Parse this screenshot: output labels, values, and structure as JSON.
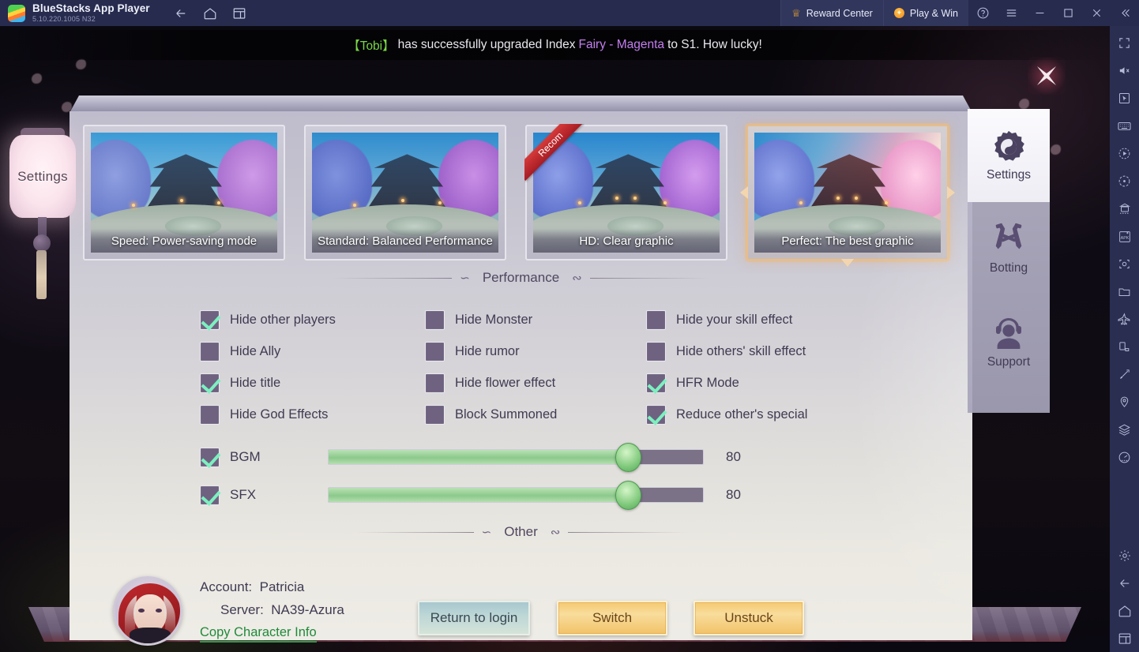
{
  "titlebar": {
    "app_title": "BlueStacks App Player",
    "version": "5.10.220.1005  N32",
    "nav": [
      {
        "name": "back-button",
        "icon": "arrow-left-icon"
      },
      {
        "name": "home-button",
        "icon": "home-icon"
      },
      {
        "name": "multi-instance-button",
        "icon": "windows-icon"
      }
    ],
    "reward_center": "Reward Center",
    "play_and_win": "Play & Win",
    "window_controls": [
      "help-icon",
      "menu-icon",
      "minimize-icon",
      "maximize-icon",
      "close-icon",
      "collapse-icon"
    ]
  },
  "bs_sidebar": {
    "icons": [
      "fullscreen-icon",
      "mute-icon",
      "pointer-icon",
      "keyboard-icon",
      "record-icon",
      "macro-icon",
      "multi-instance-manager-icon",
      "install-apk-icon",
      "screenshot-icon",
      "media-folder-icon",
      "airplane-icon",
      "rotate-icon",
      "trim-icon",
      "location-icon",
      "layers-icon",
      "performance-icon",
      "settings-gear-icon",
      "back-icon",
      "home-icon",
      "recents-icon"
    ]
  },
  "notification": {
    "player": "【Tobi】",
    "mid_text": "has successfully upgraded Index",
    "item": "Fairy - Magenta",
    "end_text": "to S1. How lucky!",
    "close_icon": "close-x-icon"
  },
  "left_tab": {
    "label": "Settings"
  },
  "presets": {
    "ribbon_label": "Recom",
    "items": [
      {
        "name": "preset-speed",
        "label": "Speed: Power-saving mode",
        "selected": false,
        "recommended": false
      },
      {
        "name": "preset-standard",
        "label": "Standard: Balanced Performance",
        "selected": false,
        "recommended": false
      },
      {
        "name": "preset-hd",
        "label": "HD: Clear graphic",
        "selected": false,
        "recommended": true
      },
      {
        "name": "preset-perfect",
        "label": "Perfect: The best graphic",
        "selected": true,
        "recommended": false
      }
    ]
  },
  "sections": {
    "performance": "Performance",
    "other": "Other"
  },
  "options": [
    {
      "name": "hide-other-players",
      "label": "Hide other players",
      "checked": true
    },
    {
      "name": "hide-monster",
      "label": "Hide Monster",
      "checked": false
    },
    {
      "name": "hide-your-skill-effect",
      "label": "Hide your skill effect",
      "checked": false
    },
    {
      "name": "hide-ally",
      "label": "Hide Ally",
      "checked": false
    },
    {
      "name": "hide-rumor",
      "label": "Hide rumor",
      "checked": false
    },
    {
      "name": "hide-others-skill-effect",
      "label": "Hide others' skill effect",
      "checked": false
    },
    {
      "name": "hide-title",
      "label": "Hide title",
      "checked": true
    },
    {
      "name": "hide-flower-effect",
      "label": "Hide flower effect",
      "checked": false
    },
    {
      "name": "hfr-mode",
      "label": "HFR Mode",
      "checked": true
    },
    {
      "name": "hide-god-effects",
      "label": "Hide God Effects",
      "checked": false
    },
    {
      "name": "block-summoned",
      "label": "Block Summoned",
      "checked": false
    },
    {
      "name": "reduce-others-special",
      "label": "Reduce other's special",
      "checked": true
    }
  ],
  "sliders": [
    {
      "name": "bgm",
      "label": "BGM",
      "checked": true,
      "value": 80,
      "value_text": "80",
      "max": 100
    },
    {
      "name": "sfx",
      "label": "SFX",
      "checked": true,
      "value": 80,
      "value_text": "80",
      "max": 100
    }
  ],
  "account": {
    "account_label": "Account:",
    "account_value": "Patricia",
    "server_label": "Server:",
    "server_value": "NA39-Azura",
    "copy_link": "Copy Character Info"
  },
  "buttons": {
    "return_to_login": "Return to login",
    "switch": "Switch",
    "unstuck": "Unstuck"
  },
  "rail": [
    {
      "name": "rail-settings",
      "label": "Settings",
      "icon": "gear-yinyang-icon",
      "active": true
    },
    {
      "name": "rail-botting",
      "label": "Botting",
      "icon": "crossed-swords-icon",
      "active": false
    },
    {
      "name": "rail-support",
      "label": "Support",
      "icon": "headset-person-icon",
      "active": false
    }
  ],
  "colors": {
    "titlebar_bg": "#272b4d",
    "accent_gold": "#f2c268",
    "accent_green": "#8cc98b",
    "check_green": "#7df0c0",
    "link_green": "#1f8a3a",
    "selected_border": "#e8bd87",
    "panel_bg": "#d7d5d8",
    "checkbox_bg": "#6e6280"
  }
}
